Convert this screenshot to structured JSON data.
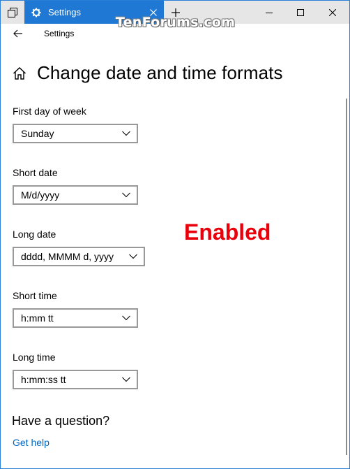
{
  "titlebar": {
    "tab_label": "Settings",
    "watermark": "TenForums.com"
  },
  "header": {
    "app_title": "Settings",
    "page_title": "Change date and time formats"
  },
  "fields": [
    {
      "label": "First day of week",
      "value": "Sunday"
    },
    {
      "label": "Short date",
      "value": "M/d/yyyy"
    },
    {
      "label": "Long date",
      "value": "dddd, MMMM d, yyyy"
    },
    {
      "label": "Short time",
      "value": "h:mm tt"
    },
    {
      "label": "Long time",
      "value": "h:mm:ss tt"
    }
  ],
  "annotation": {
    "text": "Enabled",
    "color": "#e8000b"
  },
  "help": {
    "heading": "Have a question?",
    "link": "Get help"
  },
  "colors": {
    "accent": "#1f79d4",
    "link": "#0067c0"
  },
  "icons": [
    "sets-icon",
    "gear-icon",
    "close-icon",
    "plus-icon",
    "minimize-icon",
    "maximize-icon",
    "back-arrow-icon",
    "home-icon",
    "chevron-down-icon"
  ]
}
